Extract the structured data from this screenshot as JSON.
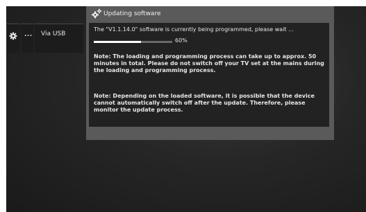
{
  "menu": {
    "settings_icon": "gear-icon",
    "more_label": "...",
    "source_label": "Via USB"
  },
  "dialog": {
    "icon": "gears-icon",
    "title": "Updating software",
    "message": "The \"V1.1.14.0\" software is currently being programmed, please wait ...",
    "progress": {
      "percent": 60,
      "label": "60%"
    },
    "note1": "Note: The loading and programming process can take up to approx. 50 minutes in total. Please do not switch off your TV set at the mains during the loading and programming process.",
    "note2": "Note: Depending on the loaded software, it is possible that the device cannot automatically switch off after the update. Therefore, please monitor the update process."
  },
  "colors": {
    "background": "#262626",
    "dialog_frame": "#5a5a5a",
    "dialog_body": "#222222",
    "progress_fill": "#ffffff"
  }
}
